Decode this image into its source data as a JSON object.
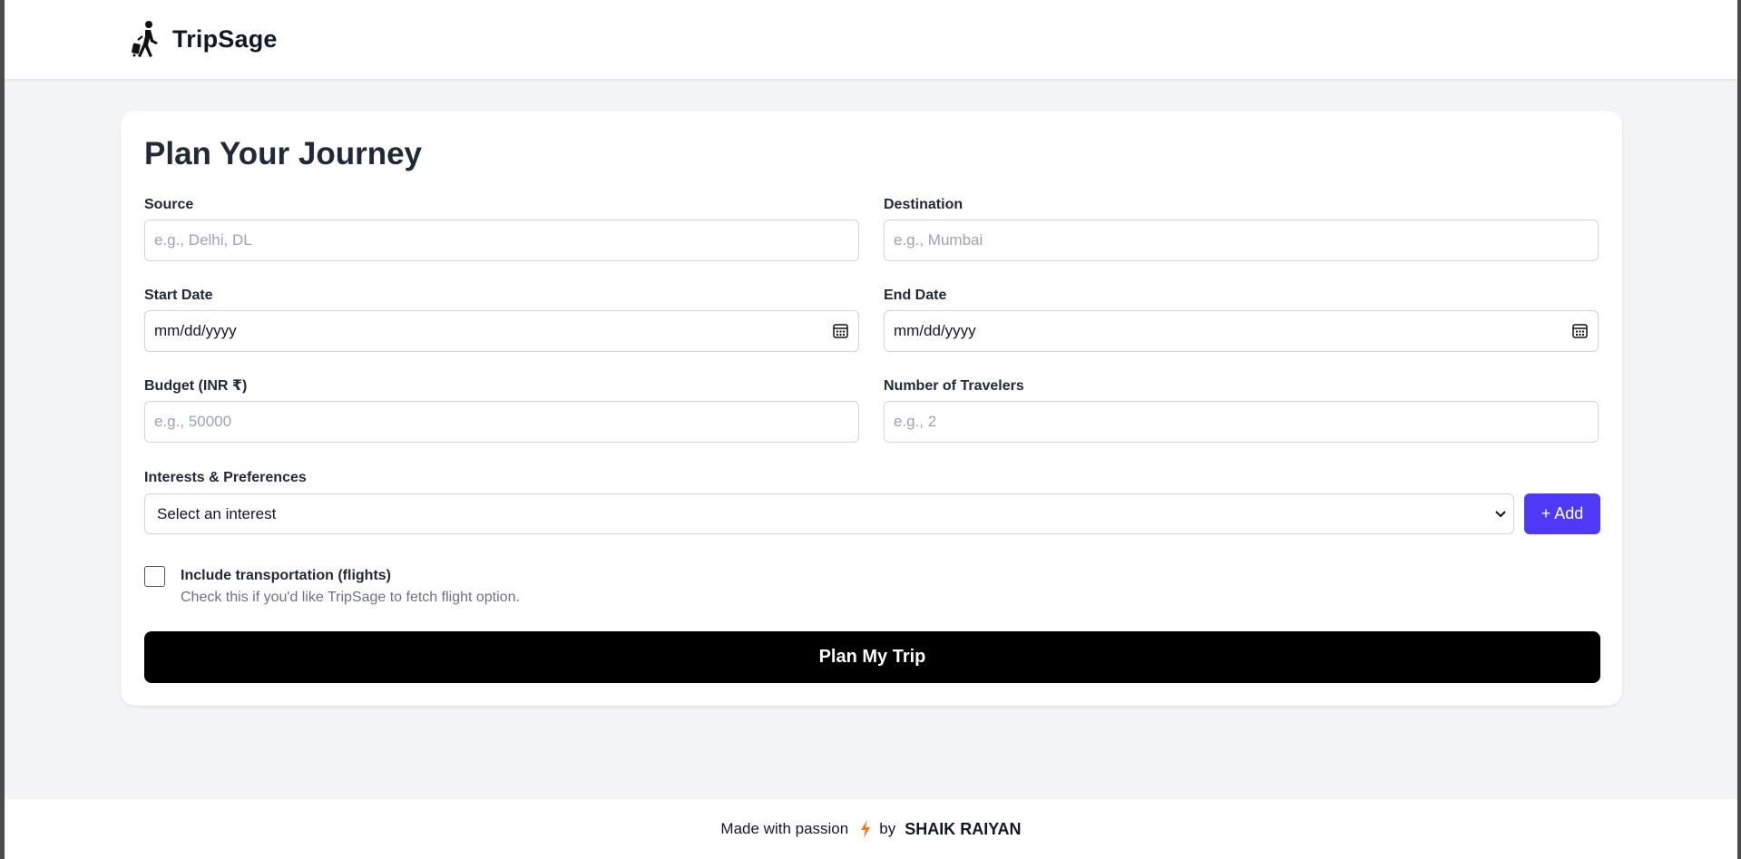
{
  "header": {
    "brand_name": "TripSage",
    "logo_icon": "traveler-with-luggage-icon"
  },
  "form": {
    "title": "Plan Your Journey",
    "source": {
      "label": "Source",
      "placeholder": "e.g., Delhi, DL"
    },
    "destination": {
      "label": "Destination",
      "placeholder": "e.g., Mumbai"
    },
    "start_date": {
      "label": "Start Date",
      "value": "mm/dd/yyyy",
      "icon": "calendar-icon"
    },
    "end_date": {
      "label": "End Date",
      "value": "mm/dd/yyyy",
      "icon": "calendar-icon"
    },
    "budget": {
      "label": "Budget (INR ₹)",
      "placeholder": "e.g., 50000"
    },
    "travelers": {
      "label": "Number of Travelers",
      "placeholder": "e.g., 2"
    },
    "interests": {
      "label": "Interests & Preferences",
      "selected": "Select an interest",
      "add_label": "+ Add"
    },
    "transport": {
      "checked": false,
      "label": "Include transportation (flights)",
      "help": "Check this if you'd like TripSage to fetch flight option."
    },
    "submit_label": "Plan My Trip"
  },
  "footer": {
    "prefix": "Made with passion",
    "icon": "lightning-bolt-icon",
    "by": "by",
    "author": "SHAIK RAIYAN"
  },
  "colors": {
    "page_bg": "#f3f4f6",
    "accent": "#4f39f6",
    "submit_bg": "#000000",
    "bolt": "#f97316"
  }
}
